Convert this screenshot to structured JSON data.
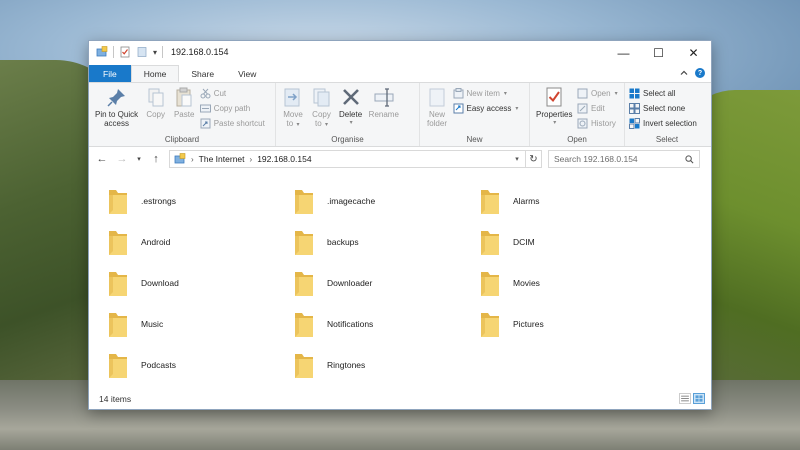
{
  "window": {
    "title": "192.168.0.154"
  },
  "tabs": [
    {
      "label": "File"
    },
    {
      "label": "Home"
    },
    {
      "label": "Share"
    },
    {
      "label": "View"
    }
  ],
  "ribbon": {
    "clipboard": {
      "label": "Clipboard",
      "pin_label_1": "Pin to Quick",
      "pin_label_2": "access",
      "copy_label": "Copy",
      "paste_label": "Paste",
      "cut_label": "Cut",
      "copy_path_label": "Copy path",
      "paste_shortcut_label": "Paste shortcut"
    },
    "organise": {
      "label": "Organise",
      "move_label_1": "Move",
      "move_label_2": "to",
      "copy_to_label_1": "Copy",
      "copy_to_label_2": "to",
      "delete_label": "Delete",
      "rename_label": "Rename"
    },
    "new": {
      "label": "New",
      "new_folder_label_1": "New",
      "new_folder_label_2": "folder",
      "new_item_label": "New item",
      "easy_access_label": "Easy access"
    },
    "open": {
      "label": "Open",
      "properties_label": "Properties",
      "open_label": "Open",
      "edit_label": "Edit",
      "history_label": "History"
    },
    "select": {
      "label": "Select",
      "select_all_label": "Select all",
      "select_none_label": "Select none",
      "invert_label": "Invert selection"
    }
  },
  "address": {
    "crumbs": [
      "The Internet",
      "192.168.0.154"
    ],
    "search_placeholder": "Search 192.168.0.154"
  },
  "folders": [
    ".estrongs",
    ".imagecache",
    "Alarms",
    "Android",
    "backups",
    "DCIM",
    "Download",
    "Downloader",
    "Movies",
    "Music",
    "Notifications",
    "Pictures",
    "Podcasts",
    "Ringtones"
  ],
  "status": {
    "item_count": "14 items"
  },
  "colors": {
    "accent": "#1979ca",
    "folder": "#f6d573",
    "folder_dark": "#e4b648"
  },
  "icons": {
    "pin": "pin-icon",
    "copy": "copy-icon",
    "paste": "paste-icon",
    "cut": "scissors-icon",
    "move": "move-to-icon",
    "delete": "delete-x-icon",
    "rename": "rename-icon",
    "new_folder": "new-folder-icon",
    "properties": "properties-check-icon",
    "select_all": "select-all-icon",
    "folder": "folder-icon"
  }
}
